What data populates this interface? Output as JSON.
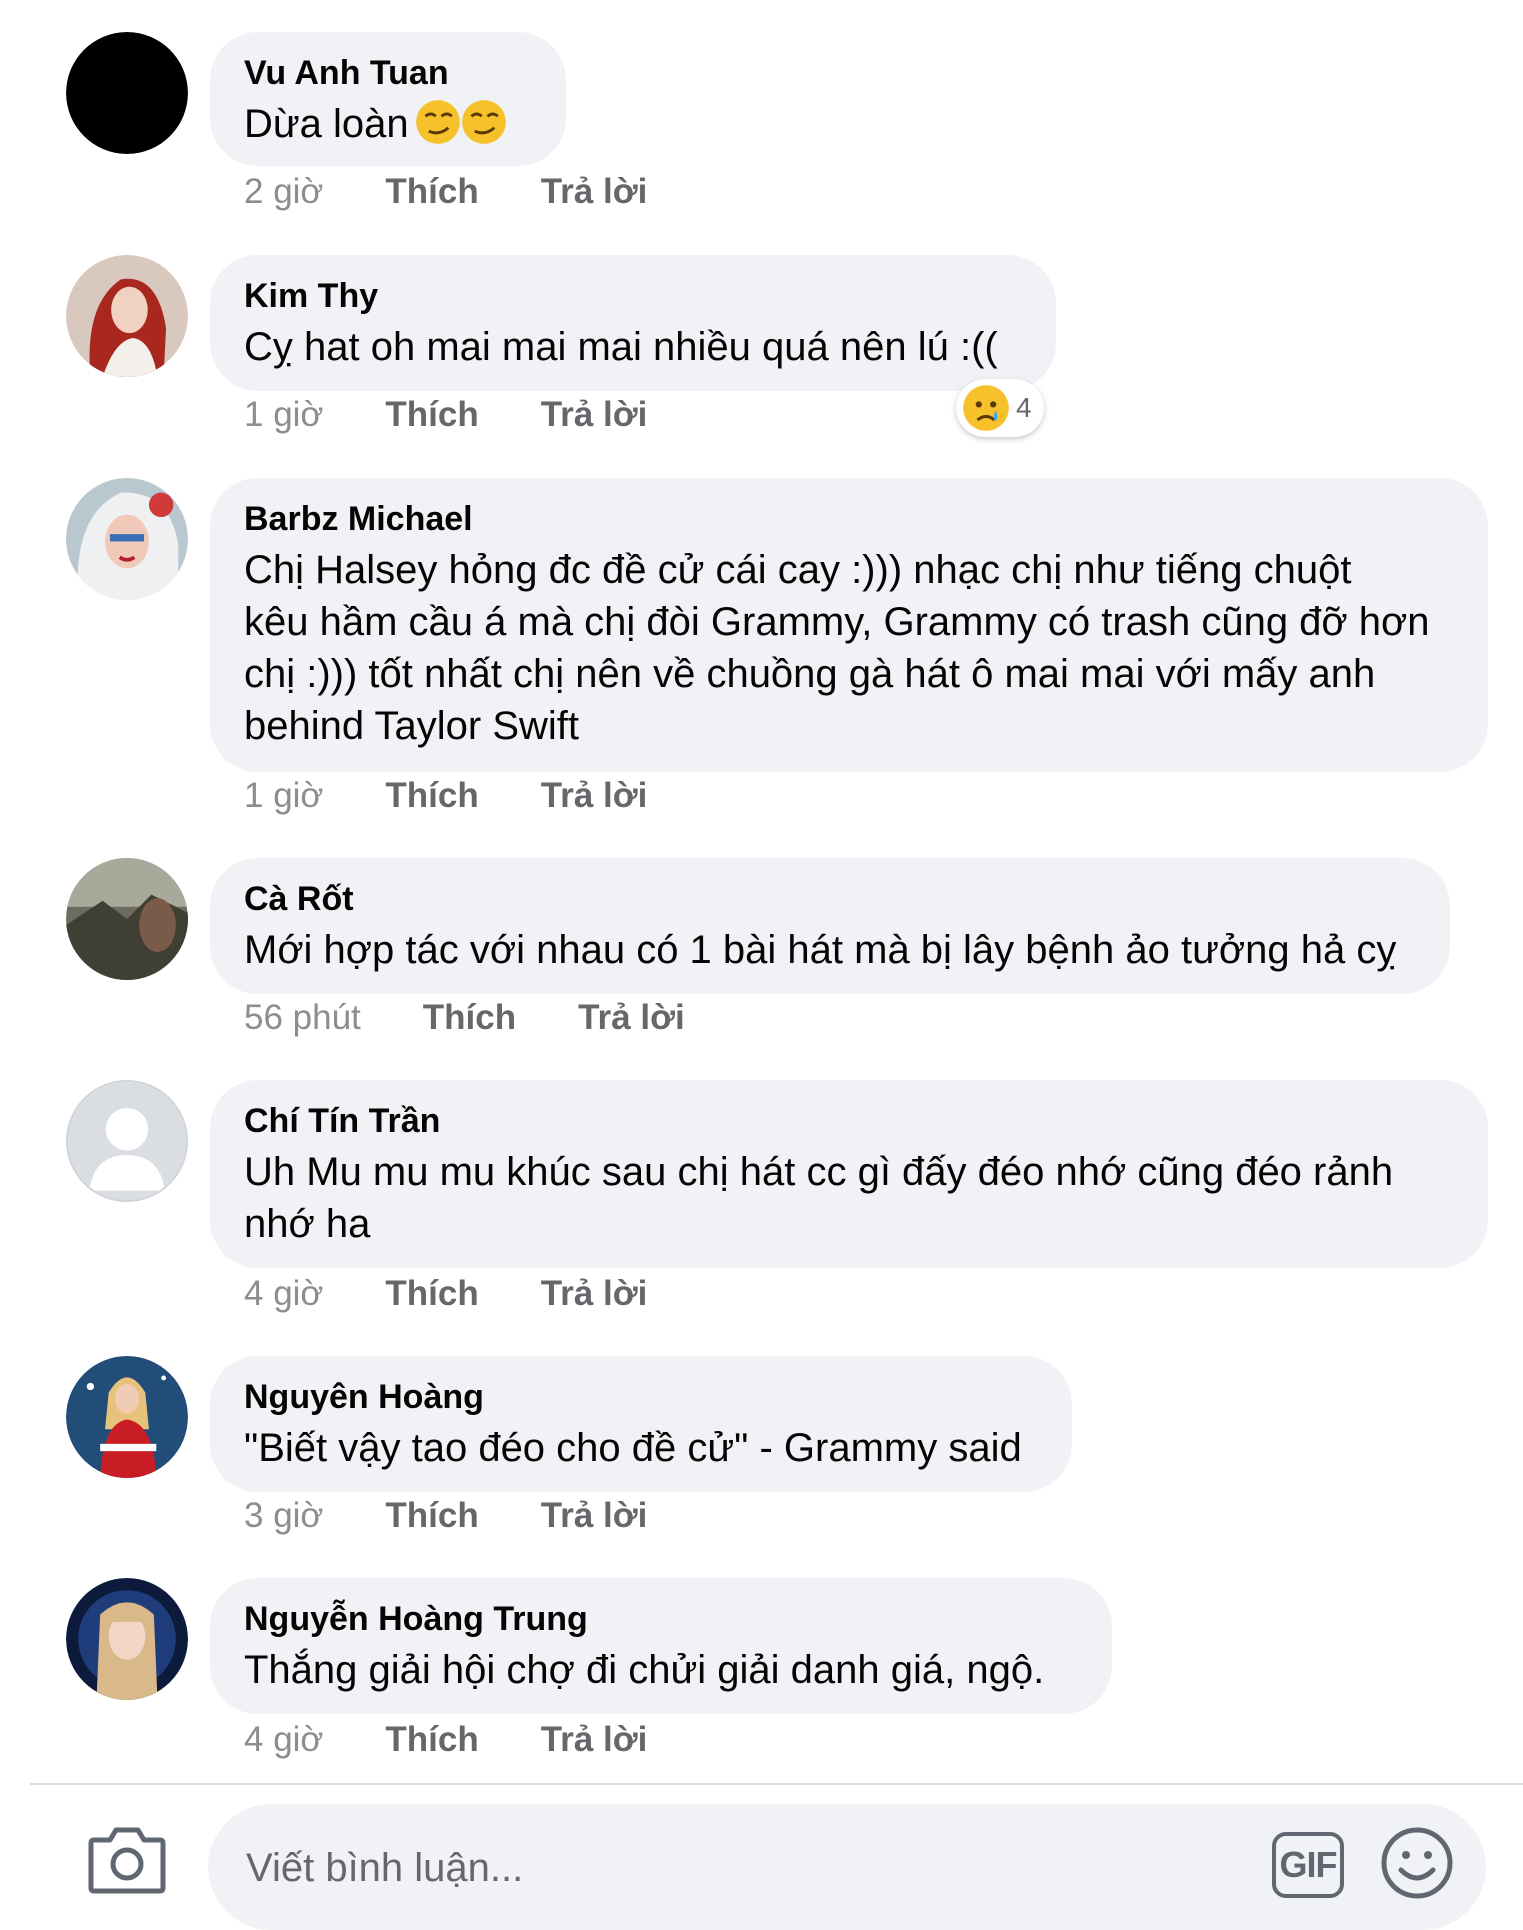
{
  "comments": [
    {
      "author": "Vu Anh Tuan",
      "text": "Dừa loàn",
      "emoji": "smirk-emoji",
      "time": "2 giờ",
      "like": "Thích",
      "reply": "Trả lời"
    },
    {
      "author": "Kim Thy",
      "text": "Cỵ hat oh mai mai mai nhiều quá nên lú :((",
      "time": "1 giờ",
      "like": "Thích",
      "reply": "Trả lời",
      "reaction": {
        "icon": "sad-tear-emoji",
        "count": "4"
      }
    },
    {
      "author": "Barbz Michael",
      "lines": [
        "Chị Halsey hỏng đc đề cử cái cay :))) nhạc chị như tiếng chuột",
        "kêu hầm cầu á mà chị đòi Grammy, Grammy có trash cũng đỡ hơn",
        "chị :))) tốt nhất chị nên về chuồng gà hát ô mai mai với mấy anh",
        "behind Taylor Swift"
      ],
      "time": "1 giờ",
      "like": "Thích",
      "reply": "Trả lời"
    },
    {
      "author": "Cà Rốt",
      "text": "Mới hợp tác với nhau có 1 bài hát mà bị lây bệnh ảo tưởng hả cỵ",
      "time": "56 phút",
      "like": "Thích",
      "reply": "Trả lời"
    },
    {
      "author": "Chí Tín Trần",
      "lines": [
        "Uh Mu mu mu khúc sau chị hát cc gì đấy đéo nhớ cũng đéo rảnh",
        "nhớ ha"
      ],
      "time": "4 giờ",
      "like": "Thích",
      "reply": "Trả lời"
    },
    {
      "author": "Nguyên Hoàng",
      "text": "\"Biết vậy tao đéo cho đề cử\" - Grammy said",
      "time": "3 giờ",
      "like": "Thích",
      "reply": "Trả lời"
    },
    {
      "author": "Nguyễn Hoàng Trung",
      "text": "Thắng giải hội chợ đi chửi giải danh giá,  ngộ.",
      "time": "4 giờ",
      "like": "Thích",
      "reply": "Trả lời"
    }
  ],
  "composer": {
    "placeholder": "Viết bình luận...",
    "gif_label": "GIF",
    "camera_icon": "camera-icon",
    "emoji_icon": "smiley-icon"
  },
  "colors": {
    "bubble": "#f0f2f5",
    "meta": "#65676b",
    "text": "#050505",
    "divider": "#dadde1"
  }
}
